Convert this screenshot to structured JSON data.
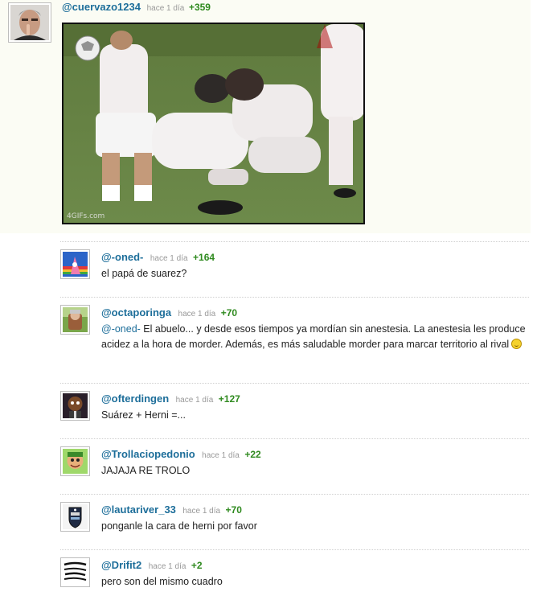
{
  "post": {
    "username": "@cuervazo1234",
    "time": "hace 1 día",
    "score": "+359",
    "media_watermark": "4GIFs.com"
  },
  "replies": [
    {
      "username": "@-oned-",
      "time": "hace 1 día",
      "score": "+164",
      "mention": "",
      "text": "el papá de suarez?"
    },
    {
      "username": "@octaporinga",
      "time": "hace 1 día",
      "score": "+70",
      "mention": "@-oned-",
      "text": " El abuelo... y desde esos tiempos ya mordían sin anestesia. La anestesia les produce acidez a la hora de morder. Además, es más saludable morder para marcar territorio al rival"
    },
    {
      "username": "@ofterdingen",
      "time": "hace 1 día",
      "score": "+127",
      "mention": "",
      "text": "Suárez + Herni =..."
    },
    {
      "username": "@Trollaciopedonio",
      "time": "hace 1 día",
      "score": "+22",
      "mention": "",
      "text": "JAJAJA RE TROLO"
    },
    {
      "username": "@lautariver_33",
      "time": "hace 1 día",
      "score": "+70",
      "mention": "",
      "text": "ponganle la cara de herni por favor"
    },
    {
      "username": "@Drifit2",
      "time": "hace 1 día",
      "score": "+2",
      "mention": "",
      "text": "pero son del mismo cuadro"
    }
  ],
  "colors": {
    "username": "#1d6e9a",
    "score": "#2f8a1f",
    "time": "#999999"
  }
}
